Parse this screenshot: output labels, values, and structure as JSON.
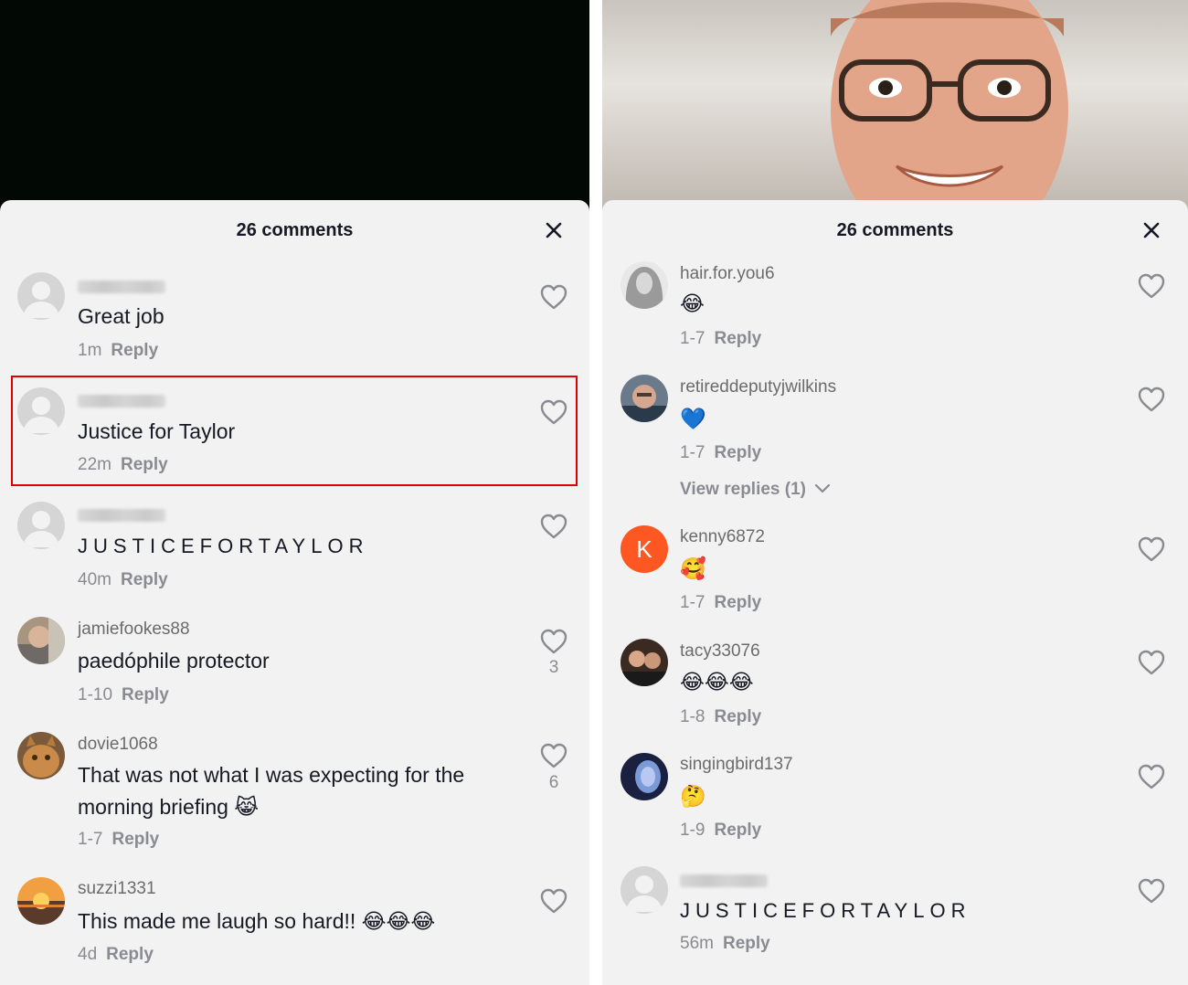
{
  "left": {
    "header": "26 comments",
    "comments": [
      {
        "username": "",
        "text": "Great job",
        "time": "1m",
        "reply": "Reply",
        "likes": ""
      },
      {
        "username": "",
        "text": "Justice for Taylor",
        "time": "22m",
        "reply": "Reply",
        "likes": ""
      },
      {
        "username": "",
        "text": "JUSTICEFORTAYLOR",
        "time": "40m",
        "reply": "Reply",
        "likes": ""
      },
      {
        "username": "jamiefookes88",
        "text": "paedóphile protector",
        "time": "1-10",
        "reply": "Reply",
        "likes": "3"
      },
      {
        "username": "dovie1068",
        "text": "That was not what I was expecting for the morning briefing 😹",
        "time": "1-7",
        "reply": "Reply",
        "likes": "6"
      },
      {
        "username": "suzzi1331",
        "text": "This made me laugh so hard!! 😂😂😂",
        "time": "4d",
        "reply": "Reply",
        "likes": ""
      }
    ]
  },
  "right": {
    "header": "26 comments",
    "comments": [
      {
        "username": "hair.for.you6",
        "text": "😂",
        "time": "1-7",
        "reply": "Reply"
      },
      {
        "username": "retireddeputyjwilkins",
        "text": "💙",
        "time": "1-7",
        "reply": "Reply",
        "view_replies": "View replies (1)"
      },
      {
        "username": "kenny6872",
        "avatar_letter": "K",
        "text": "🥰",
        "time": "1-7",
        "reply": "Reply"
      },
      {
        "username": "tacy33076",
        "text": "😂😂😂",
        "time": "1-8",
        "reply": "Reply"
      },
      {
        "username": "singingbird137",
        "text": "🤔",
        "time": "1-9",
        "reply": "Reply"
      },
      {
        "username": "",
        "text": "JUSTICEFORTAYLOR",
        "time": "56m",
        "reply": "Reply"
      }
    ]
  },
  "colors": {
    "highlight": "#e00000",
    "sheet": "#f2f2f2",
    "kenny_avatar": "#fe5722",
    "text": "#161823",
    "muted": "#8a8b91"
  }
}
